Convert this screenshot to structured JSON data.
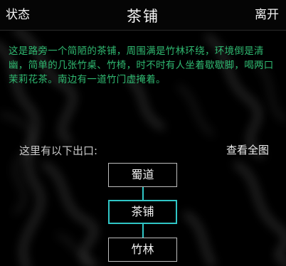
{
  "header": {
    "status_label": "状态",
    "title": "茶铺",
    "leave_label": "离开"
  },
  "description": "这是路旁一个简陋的茶铺，周围满是竹林环绕，环境倒是清幽，简单的几张竹桌、竹椅，时不时有人坐着歇歇脚，喝两口茉莉花茶。南边有一道竹门虚掩着。",
  "exits": {
    "label": "这里有以下出口:",
    "view_all_label": "查看全图",
    "north_room": "蜀道",
    "current_room": "茶铺",
    "south_room": "竹林"
  },
  "colors": {
    "description_text": "#2fb870",
    "current_room_border": "#30c6c6",
    "room_border": "#bdbdbd",
    "background": "#000000"
  }
}
